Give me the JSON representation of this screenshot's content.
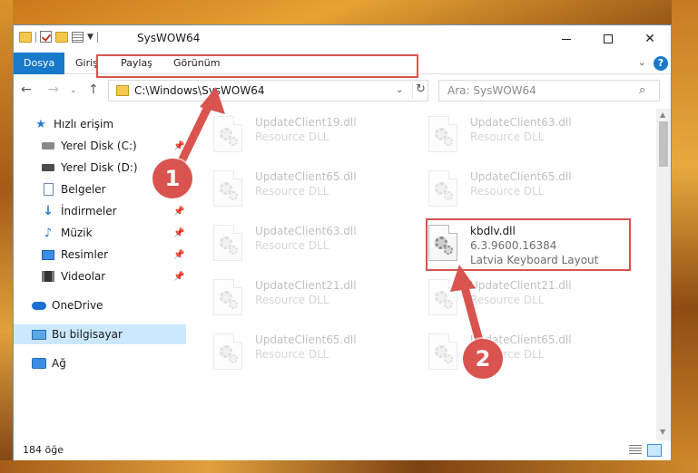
{
  "window": {
    "title": "SysWOW64"
  },
  "ribbon": {
    "tabs": [
      {
        "label": "Dosya"
      },
      {
        "label": "Giriş"
      },
      {
        "label": "Paylaş"
      },
      {
        "label": "Görünüm"
      }
    ],
    "help_label": "?"
  },
  "navbar": {
    "address": "C:\\Windows\\SysWOW64",
    "search_placeholder": "Ara: SysWOW64"
  },
  "sidebar": {
    "items": [
      {
        "label": "Hızlı erişim",
        "icon": "star-icon"
      },
      {
        "label": "Yerel Disk (C:)",
        "icon": "drive-icon",
        "pinned": true
      },
      {
        "label": "Yerel Disk (D:)",
        "icon": "drive-icon",
        "pinned": false
      },
      {
        "label": "Belgeler",
        "icon": "document-icon",
        "pinned": false
      },
      {
        "label": "İndirmeler",
        "icon": "download-icon",
        "pinned": true
      },
      {
        "label": "Müzik",
        "icon": "music-icon",
        "pinned": true
      },
      {
        "label": "Resimler",
        "icon": "picture-icon",
        "pinned": true
      },
      {
        "label": "Videolar",
        "icon": "video-icon",
        "pinned": true
      },
      {
        "label": "OneDrive",
        "icon": "cloud-icon"
      },
      {
        "label": "Bu bilgisayar",
        "icon": "computer-icon",
        "selected": true
      },
      {
        "label": "Ağ",
        "icon": "network-icon"
      }
    ]
  },
  "files": [
    {
      "name": "UpdateClient19.dll",
      "type": "Resource DLL"
    },
    {
      "name": "UpdateClient63.dll",
      "type": "Resource DLL"
    },
    {
      "name": "UpdateClient65.dll",
      "type": "Resource DLL"
    },
    {
      "name": "UpdateClient65.dll",
      "type": "Resource DLL"
    },
    {
      "name": "UpdateClient63.dll",
      "type": "Resource DLL"
    },
    {
      "name": "kbdlv.dll",
      "version": "6.3.9600.16384",
      "description": "Latvia Keyboard Layout",
      "highlighted": true
    },
    {
      "name": "UpdateClient21.dll",
      "type": "Resource DLL"
    },
    {
      "name": "UpdateClient21.dll",
      "type": "Resource DLL"
    },
    {
      "name": "UpdateClient65.dll",
      "type": "Resource DLL"
    },
    {
      "name": "UpdateClient65.dll",
      "type": "Resource DLL"
    }
  ],
  "status": {
    "item_count": "184 öğe"
  },
  "callouts": [
    "1",
    "2"
  ],
  "colors": {
    "accent": "#1979ca",
    "highlight": "#d9534f",
    "selection": "#cce8ff"
  }
}
